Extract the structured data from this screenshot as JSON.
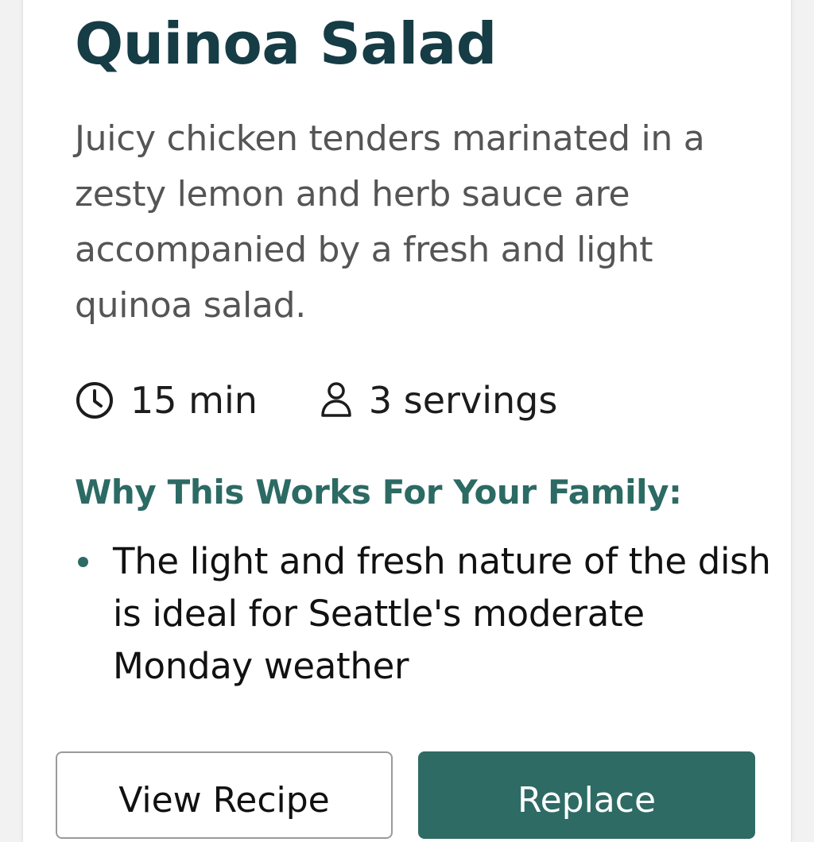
{
  "recipe": {
    "title": "Quinoa Salad",
    "description": "Juicy chicken tenders marinated in a zesty lemon and herb sauce are accompanied by a fresh and light quinoa salad.",
    "time": "15 min",
    "servings": "3 servings",
    "time_icon": "clock-icon",
    "servings_icon": "person-icon"
  },
  "why": {
    "heading": "Why This Works For Your Family:",
    "reasons": [
      "The light and fresh nature of the dish is ideal for Seattle's moderate Monday weather"
    ]
  },
  "actions": {
    "view_label": "View Recipe",
    "replace_label": "Replace"
  },
  "colors": {
    "title": "#163c45",
    "accent": "#2c6a64",
    "button_primary": "#2e6b64"
  }
}
